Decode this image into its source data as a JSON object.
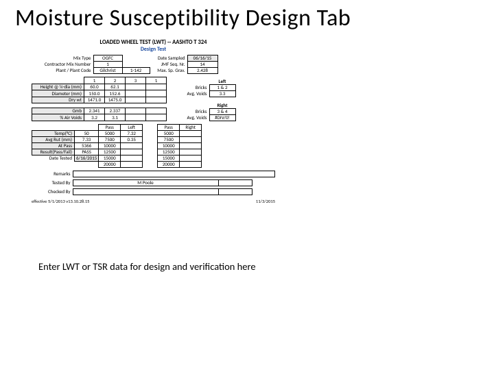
{
  "slide": {
    "title": "Moisture Susceptibility Design Tab",
    "caption": "Enter LWT or TSR data for design and verification here"
  },
  "form": {
    "header1": "LOADED WHEEL TEST (LWT) -- AASHTO T 324",
    "header2": "Design Test",
    "top": {
      "mix_type_label": "Mix Type",
      "mix_type": "OGFC",
      "date_sampled_label": "Date Sampled",
      "date_sampled": "06/16/15",
      "contractor_mix_label": "Contractor Mix Number",
      "contractor_mix": "1",
      "jmf_seq_label": "JMF Seq. Nr.",
      "jmf_seq": "14",
      "plant_label": "Plant / Plant Code",
      "plant_name": "Gilchrist",
      "plant_code": "1-142",
      "max_sp_gr_label": "Max. Sp. Grav.",
      "max_sp_gr": "2.428"
    },
    "sample_cols": [
      "1",
      "2",
      "3",
      "1"
    ],
    "height_label": "Height @ ¼-dia (mm)",
    "height": [
      "60.0",
      "62.1",
      "",
      ""
    ],
    "diameter_label": "Diameter (mm)",
    "diameter": [
      "150.0",
      "152.6",
      "",
      ""
    ],
    "drywt_label": "Dry wt",
    "drywt": [
      "1471.0",
      "1475.0",
      "",
      ""
    ],
    "gmb_label": "Gmb",
    "gmb": [
      "2.341",
      "2.337",
      "",
      ""
    ],
    "air_voids_label": "% Air Voids",
    "air_voids": [
      "3.2",
      "3.1",
      "",
      ""
    ],
    "left_section": "Left",
    "right_section": "Right",
    "bricks_label": "Bricks",
    "left_bricks": "1 & 2",
    "left_avg_voids_label": "Avg. Voids",
    "left_avg_voids": "3.3",
    "right_bricks": "3 & 4",
    "right_avg_voids_label": "Avg. Voids",
    "right_avg_voids": "#DIV/0!",
    "passes_hdr": [
      "Pass",
      "Left",
      "Pass",
      "Right"
    ],
    "temp_label": "Temp(°C)",
    "temp": "50",
    "avg_rut_label": "Avg Rut (mm)",
    "avg_rut": [
      "7.33",
      "5000",
      "7.32",
      "5000",
      ""
    ],
    "at_pass_label": "At Pass",
    "at_pass": [
      "5366",
      "7500",
      "0.35",
      "7500",
      ""
    ],
    "result_label": "Result(Pass/Fail)",
    "result": "PASS",
    "passes_rows": [
      [
        "10000",
        "",
        "10000",
        ""
      ],
      [
        "12500",
        "",
        "12500",
        ""
      ],
      [
        "15000",
        "",
        "15000",
        ""
      ],
      [
        "20000",
        "",
        "20000",
        ""
      ]
    ],
    "date_tested_label": "Date Tested",
    "date_tested": "6/16/2015",
    "remarks_label": "Remarks",
    "tested_by_label": "Tested By",
    "tested_by": "M Poole",
    "checked_by_label": "Checked By",
    "footer_left": "effective 5/1/2013 v13.10.28.15",
    "footer_right": "11/3/2015"
  }
}
